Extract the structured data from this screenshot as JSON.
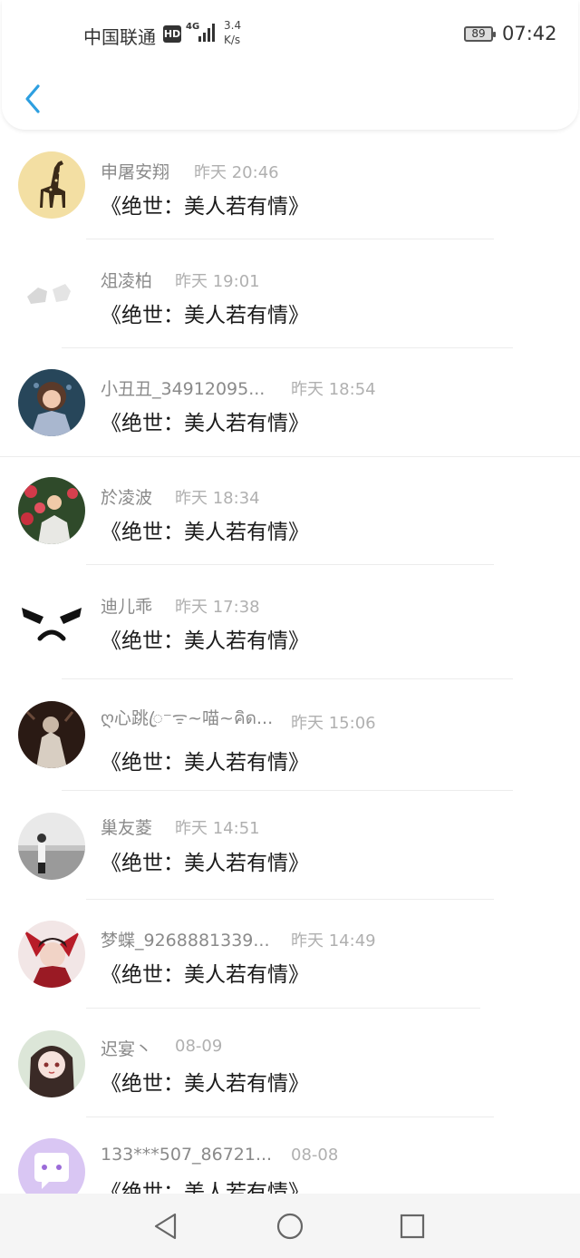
{
  "status_bar": {
    "carrier": "中国联通",
    "hd": "HD",
    "network": "4G",
    "speed_value": "3.4",
    "speed_unit": "K/s",
    "battery": "89",
    "time": "07:42"
  },
  "header": {
    "back_icon": "chevron-left-icon"
  },
  "comments": [
    {
      "name": "申屠安翔",
      "time": "昨天 20:46",
      "message": "《绝世：美人若有情》",
      "avatar": "giraffe"
    },
    {
      "name": "俎凌柏",
      "time": "昨天 19:01",
      "message": "《绝世：美人若有情》",
      "avatar": "blank-grey"
    },
    {
      "name": "小丑丑_34912095...",
      "time": "昨天 18:54",
      "message": "《绝世：美人若有情》",
      "avatar": "girl-portrait"
    },
    {
      "name": "於凌波",
      "time": "昨天 18:34",
      "message": "《绝世：美人若有情》",
      "avatar": "woman-flowers"
    },
    {
      "name": "迪儿乖",
      "time": "昨天 17:38",
      "message": "《绝世：美人若有情》",
      "avatar": "angry-face"
    },
    {
      "name": "ღ心跳ꦿ⁻ᯤ~喵~คิด...",
      "time": "昨天 15:06",
      "message": "《绝世：美人若有情》",
      "avatar": "dark-figure"
    },
    {
      "name": "巢友菱",
      "time": "昨天 14:51",
      "message": "《绝世：美人若有情》",
      "avatar": "beach-person"
    },
    {
      "name": "梦蝶_9268881339...",
      "time": "昨天 14:49",
      "message": "《绝世：美人若有情》",
      "avatar": "red-anime"
    },
    {
      "name": "迟宴丶",
      "time": "08-09",
      "message": "《绝世：美人若有情》",
      "avatar": "anime-girl"
    },
    {
      "name": "133***507_86721...",
      "time": "08-08",
      "message": "《绝世：美人若有情》",
      "avatar": "chat-bubble"
    }
  ],
  "nav_bar": {
    "back": "triangle-back-icon",
    "home": "circle-home-icon",
    "recents": "square-recents-icon"
  }
}
